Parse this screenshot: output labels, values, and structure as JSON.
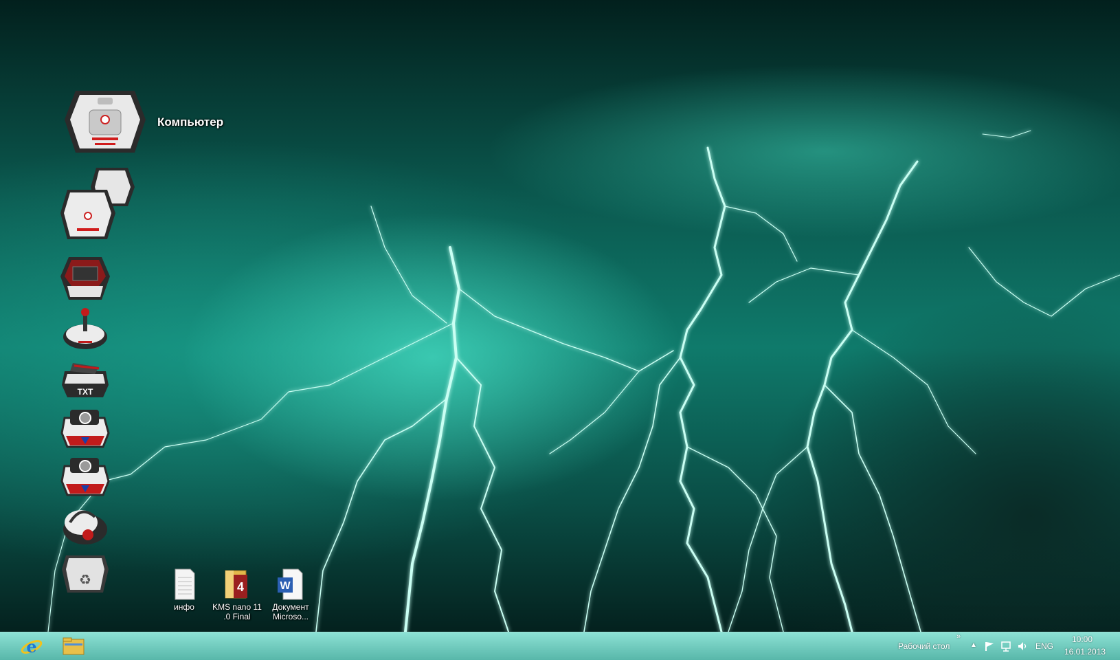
{
  "desktop": {
    "computer_label": "Компьютер",
    "files": [
      {
        "label": "инфо",
        "icon": "text-file-icon"
      },
      {
        "label": "KMS nano 11 .0 Final",
        "icon": "archive-folder-icon"
      },
      {
        "label": "Документ Microso...",
        "icon": "word-document-icon"
      }
    ],
    "side_icons": [
      "network-computers-icon",
      "control-panel-icon",
      "game-controller-icon",
      "text-editor-icon",
      "camera-icon",
      "camera-alt-icon",
      "headphones-icon",
      "recycle-bin-icon"
    ]
  },
  "taskbar": {
    "pinned": [
      "internet-explorer-icon",
      "file-explorer-icon"
    ],
    "toolbar_label": "Рабочий стол",
    "language": "ENG",
    "time": "10:00",
    "date": "16.01.2013"
  },
  "colors": {
    "taskbar": "#5fbfb0",
    "lightning": "#bffff2"
  }
}
